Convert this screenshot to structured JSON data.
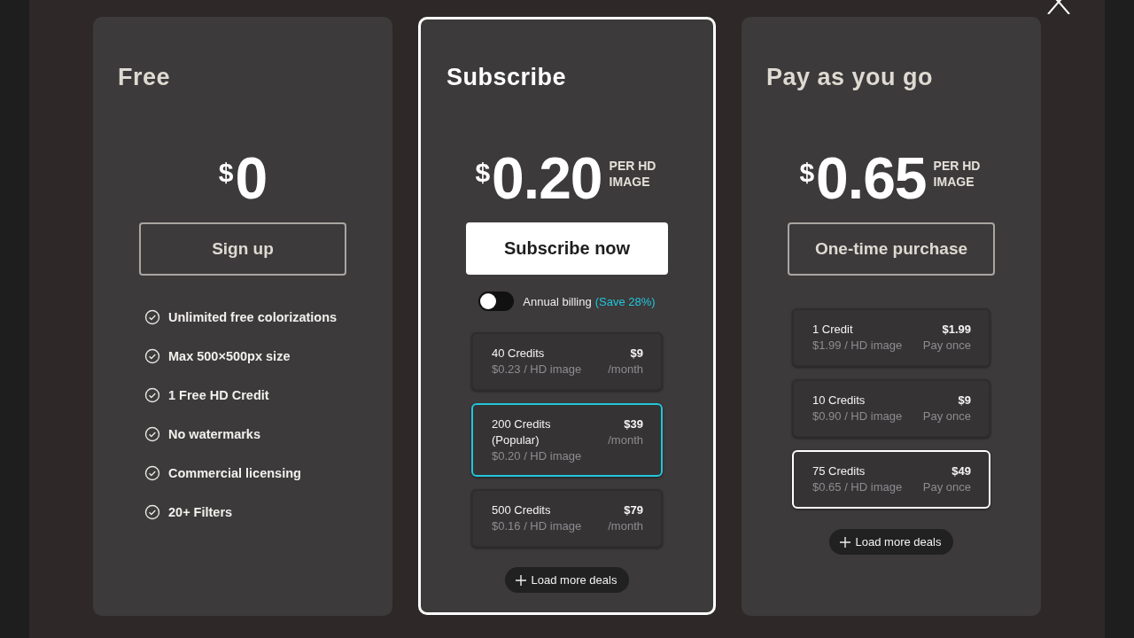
{
  "plans": [
    {
      "kind": "free",
      "featured": false,
      "title": "Free",
      "price": {
        "currency": "$",
        "amount": "0"
      },
      "button": "Sign up",
      "features": [
        "Unlimited free colorizations",
        "Max 500×500px size",
        "1 Free HD Credit",
        "No watermarks",
        "Commercial licensing",
        "20+ Filters"
      ]
    },
    {
      "kind": "subscription",
      "featured": true,
      "title": "Subscribe",
      "price": {
        "currency": "$",
        "amount": "0.20",
        "unit": "PER HD IMAGE"
      },
      "button": "Subscribe now",
      "toggle": {
        "label": "Annual billing",
        "note": "(Save 28%)",
        "on": false
      },
      "deals": [
        {
          "name": "40 Credits",
          "rate": "$0.23 / HD image",
          "price": "$9",
          "term": "/month",
          "selected": false
        },
        {
          "name": "200 Credits (Popular)",
          "rate": "$0.20 / HD image",
          "price": "$39",
          "term": "/month",
          "selected": true
        },
        {
          "name": "500 Credits",
          "rate": "$0.16 / HD image",
          "price": "$79",
          "term": "/month",
          "selected": false
        }
      ],
      "more": "Load more deals"
    },
    {
      "kind": "one_time",
      "featured": false,
      "title": "Pay as you go",
      "price": {
        "currency": "$",
        "amount": "0.65",
        "unit": "PER HD IMAGE"
      },
      "button": "One-time purchase",
      "deals": [
        {
          "name": "1 Credit",
          "rate": "$1.99 / HD image",
          "price": "$1.99",
          "term": "Pay once",
          "selected": false
        },
        {
          "name": "10 Credits",
          "rate": "$0.90 / HD image",
          "price": "$9",
          "term": "Pay once",
          "selected": false
        },
        {
          "name": "75 Credits",
          "rate": "$0.65 / HD image",
          "price": "$49",
          "term": "Pay once",
          "selected": true
        }
      ],
      "more": "Load more deals"
    }
  ]
}
